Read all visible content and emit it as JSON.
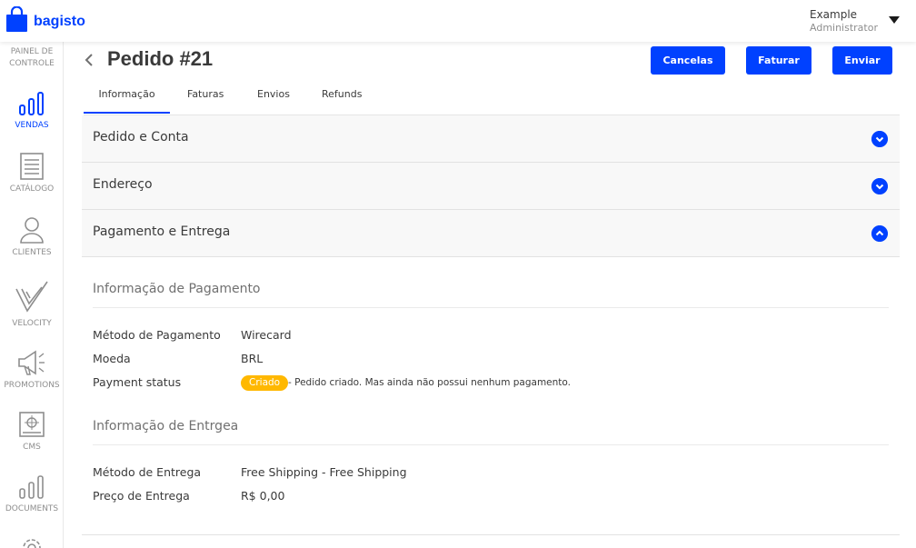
{
  "brand": {
    "name": "bagisto",
    "color": "#0041ff"
  },
  "user": {
    "name": "Example",
    "role": "Administrator"
  },
  "sidebar": {
    "items": [
      {
        "label": "PAINEL DE CONTROLE",
        "icon": "dashboard-icon"
      },
      {
        "label": "VENDAS",
        "icon": "bar-chart-icon",
        "active": true
      },
      {
        "label": "CATÁLOGO",
        "icon": "document-list-icon"
      },
      {
        "label": "CLIENTES",
        "icon": "user-icon"
      },
      {
        "label": "VELOCITY",
        "icon": "velocity-icon"
      },
      {
        "label": "PROMOTIONS",
        "icon": "megaphone-icon"
      },
      {
        "label": "CMS",
        "icon": "cms-icon"
      },
      {
        "label": "DOCUMENTS",
        "icon": "bar-chart-icon"
      }
    ],
    "item0_line1": "PAINEL DE",
    "item0_line2": "CONTROLE"
  },
  "page": {
    "title": "Pedido #21"
  },
  "actions": {
    "cancel": "Cancelas",
    "invoice": "Faturar",
    "ship": "Enviar"
  },
  "tabs": [
    {
      "label": "Informação",
      "active": true
    },
    {
      "label": "Faturas"
    },
    {
      "label": "Envios"
    },
    {
      "label": "Refunds"
    }
  ],
  "accordions": [
    {
      "title": "Pedido e Conta",
      "state": "collapsed"
    },
    {
      "title": "Endereço",
      "state": "collapsed"
    },
    {
      "title": "Pagamento e Entrega",
      "state": "expanded"
    }
  ],
  "payment": {
    "section_title": "Informação de Pagamento",
    "method_label": "Método de Pagamento",
    "method_value": "Wirecard",
    "currency_label": "Moeda",
    "currency_value": "BRL",
    "status_label": "Payment status",
    "status_badge": "Criado",
    "status_badge_color": "#ffb800",
    "status_desc": "- Pedido criado. Mas ainda não possui nenhum pagamento."
  },
  "shipping": {
    "section_title": "Informação de Entrgea",
    "method_label": "Método de Entrega",
    "method_value": "Free Shipping - Free Shipping",
    "price_label": "Preço de Entrega",
    "price_value": "R$ 0,00"
  }
}
